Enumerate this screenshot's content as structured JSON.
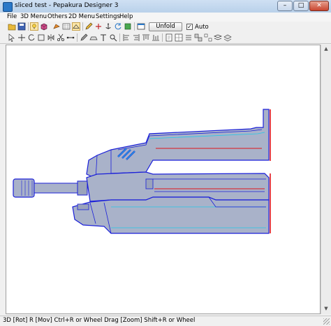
{
  "window": {
    "title": "sliced test - Pepakura Designer 3"
  },
  "menubar": {
    "items": [
      {
        "label": "File"
      },
      {
        "label": "3D Menu"
      },
      {
        "label": "Others"
      },
      {
        "label": "2D Menu"
      },
      {
        "label": "Settings"
      },
      {
        "label": "Help"
      }
    ]
  },
  "toolbar": {
    "unfold_label": "Unfold",
    "auto_label": "Auto",
    "auto_checked": true
  },
  "statusbar": {
    "text": "3D [Rot] R [Mov] Ctrl+R or Wheel Drag [Zoom] Shift+R or Wheel"
  },
  "colors": {
    "model_fill": "#a9b2c9",
    "model_edge": "#1a1fd9",
    "cut_line": "#e0141c",
    "fold_line": "#22c9e8"
  }
}
